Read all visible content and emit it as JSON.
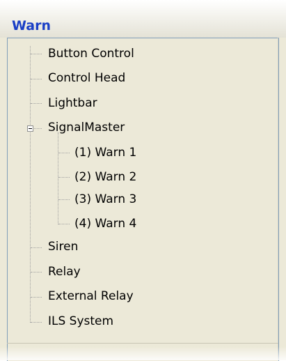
{
  "header": {
    "title": "Warn"
  },
  "tree": {
    "items": [
      {
        "label": "Button Control"
      },
      {
        "label": "Control Head"
      },
      {
        "label": "Lightbar"
      },
      {
        "label": "SignalMaster",
        "expanded": true,
        "children": [
          {
            "label": "(1) Warn 1"
          },
          {
            "label": "(2) Warn 2"
          },
          {
            "label": "(3) Warn 3"
          },
          {
            "label": "(4) Warn 4"
          }
        ]
      },
      {
        "label": "Siren"
      },
      {
        "label": "Relay"
      },
      {
        "label": "External Relay"
      },
      {
        "label": "ILS System"
      }
    ]
  },
  "colors": {
    "title": "#1a3fc6",
    "panel_bg": "#ece9d8",
    "border": "#7f9db9"
  }
}
